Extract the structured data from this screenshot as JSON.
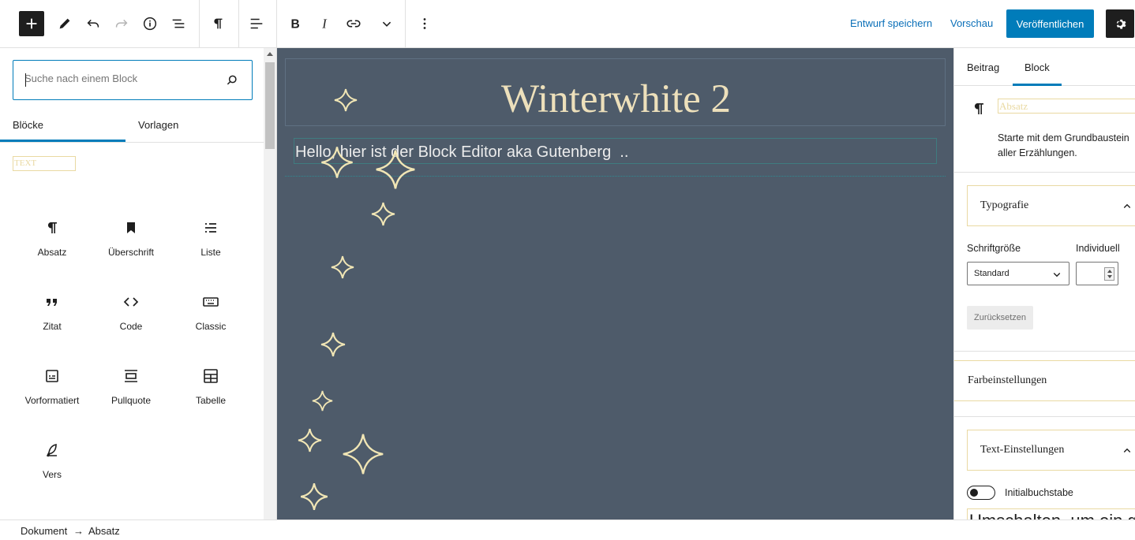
{
  "toolbar": {
    "save_draft": "Entwurf speichern",
    "preview": "Vorschau",
    "publish": "Veröffentlichen"
  },
  "inserter": {
    "search_placeholder": "Suche nach einem Block",
    "tabs": [
      "Blöcke",
      "Vorlagen"
    ],
    "category_label": "TEXT",
    "blocks": [
      {
        "label": "Absatz",
        "icon": "paragraph-icon"
      },
      {
        "label": "Überschrift",
        "icon": "bookmark-icon"
      },
      {
        "label": "Liste",
        "icon": "list-icon"
      },
      {
        "label": "Zitat",
        "icon": "quote-icon"
      },
      {
        "label": "Code",
        "icon": "code-icon"
      },
      {
        "label": "Classic",
        "icon": "keyboard-icon"
      },
      {
        "label": "Vorformatiert",
        "icon": "preformatted-icon"
      },
      {
        "label": "Pullquote",
        "icon": "pullquote-icon"
      },
      {
        "label": "Tabelle",
        "icon": "table-icon"
      },
      {
        "label": "Vers",
        "icon": "feather-icon"
      }
    ]
  },
  "canvas": {
    "title": "Winterwhite 2",
    "paragraph": "Hello, hier ist der Block Editor aka Gutenberg  .."
  },
  "sidebar": {
    "tabs": [
      "Beitrag",
      "Block"
    ],
    "block_name": "Absatz",
    "block_description": "Starte mit dem Grundbaustein\naller Erzählungen.",
    "typography_title": "Typografie",
    "font_size_label": "Schriftgröße",
    "custom_label": "Individuell",
    "font_size_value": "Standard",
    "reset": "Zurücksetzen",
    "color_settings": "Farbeinstellungen",
    "text_settings": "Text-Einstellungen",
    "drop_cap": "Initialbuchstabe",
    "cut_text": "Umschalten, um ein gr"
  },
  "footer": {
    "breadcrumb": [
      "Dokument",
      "→",
      "Absatz"
    ]
  },
  "colors": {
    "accent": "#007cba",
    "canvas_bg": "#4e5b6a",
    "title_text": "#ede0bb",
    "star": "#f1e6b5"
  }
}
